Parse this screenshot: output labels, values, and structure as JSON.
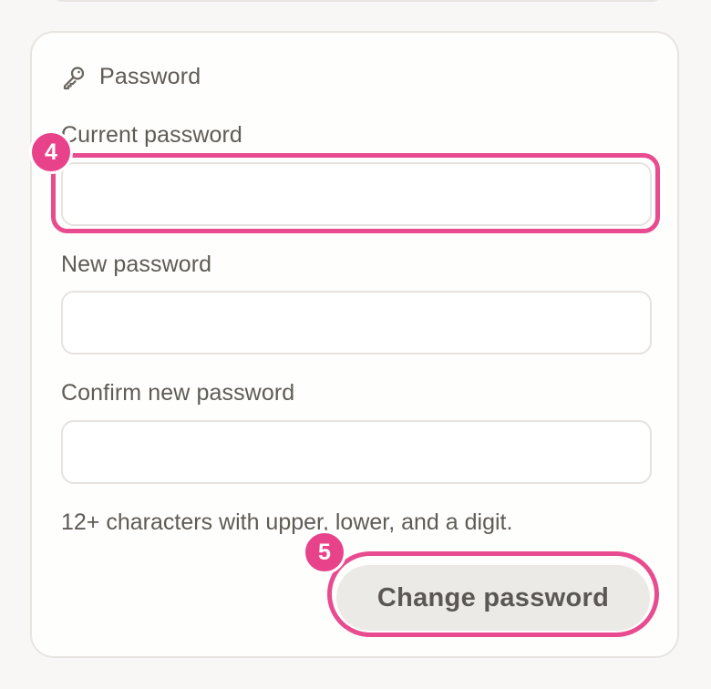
{
  "password_section": {
    "title": "Password",
    "icon": "key-icon",
    "current_password": {
      "label": "Current password",
      "value": "",
      "placeholder": ""
    },
    "new_password": {
      "label": "New password",
      "value": "",
      "placeholder": ""
    },
    "confirm_password": {
      "label": "Confirm new password",
      "value": "",
      "placeholder": ""
    },
    "hint": "12+ characters with upper, lower, and a digit.",
    "submit_label": "Change password"
  },
  "annotations": [
    {
      "number": "4",
      "target": "current-password-input"
    },
    {
      "number": "5",
      "target": "change-password-button"
    }
  ],
  "colors": {
    "accent": "#e8438a",
    "background": "#f8f7f5",
    "card": "#fefefd",
    "button": "#eceae7"
  }
}
